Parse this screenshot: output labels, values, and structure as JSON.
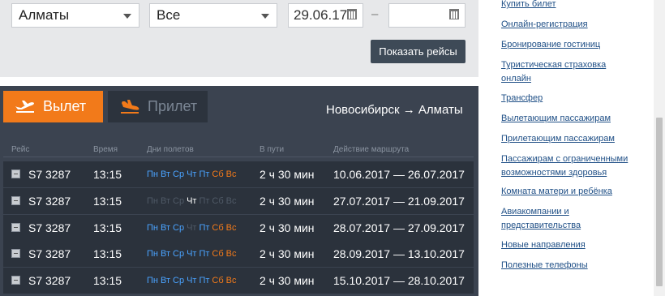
{
  "filters": {
    "city_value": "Алматы",
    "airline_value": "Все",
    "date_from": "29.06.17",
    "date_to": "",
    "dash": "–",
    "show_button": "Показать рейсы"
  },
  "board": {
    "tab_departure": "Вылет",
    "tab_arrival": "Прилет",
    "route": "Новосибирск → Алматы",
    "headers": {
      "flight": "Рейс",
      "time": "Время",
      "days": "Дни полетов",
      "duration": "В пути",
      "validity": "Действие маршрута"
    },
    "day_names": [
      "Пн",
      "Вт",
      "Ср",
      "Чт",
      "Пт",
      "Сб",
      "Вс"
    ],
    "rows": [
      {
        "flight": "S7 3287",
        "time": "13:15",
        "days_active": [
          1,
          1,
          1,
          1,
          1,
          1,
          1
        ],
        "duration": "2 ч 30 мин",
        "validity": "10.06.2017 — 26.07.2017"
      },
      {
        "flight": "S7 3287",
        "time": "13:15",
        "days_active": [
          0,
          0,
          0,
          1,
          0,
          0,
          0
        ],
        "duration": "2 ч 30 мин",
        "validity": "27.07.2017 — 21.09.2017"
      },
      {
        "flight": "S7 3287",
        "time": "13:15",
        "days_active": [
          1,
          1,
          1,
          0,
          1,
          1,
          1
        ],
        "duration": "2 ч 30 мин",
        "validity": "28.07.2017 — 27.09.2017"
      },
      {
        "flight": "S7 3287",
        "time": "13:15",
        "days_active": [
          1,
          1,
          1,
          1,
          1,
          1,
          1
        ],
        "duration": "2 ч 30 мин",
        "validity": "28.09.2017 — 13.10.2017"
      },
      {
        "flight": "S7 3287",
        "time": "13:15",
        "days_active": [
          1,
          1,
          1,
          1,
          1,
          1,
          1
        ],
        "duration": "2 ч 30 мин",
        "validity": "15.10.2017 — 28.10.2017"
      }
    ]
  },
  "sidebar": {
    "links": [
      {
        "label": "Купить билет"
      },
      {
        "label": "Онлайн-регистрация"
      },
      {
        "label": "Бронирование гостиниц"
      },
      {
        "label": "Туристическая страховка онлайн"
      },
      {
        "label": "Трансфер"
      },
      {
        "label": "Вылетающим пассажирам"
      },
      {
        "label": "Прилетающим пассажирам"
      },
      {
        "label": "Пассажирам с ограниченными возможностями здоровья"
      },
      {
        "label": "Комната матери и ребёнка"
      },
      {
        "label": "Авиакомпании и представительства"
      },
      {
        "label": "Новые направления"
      },
      {
        "label": "Полезные телефоны"
      }
    ]
  },
  "colors": {
    "accent": "#f27a1a",
    "board_bg": "#3b4350",
    "row_bg": "#2b323c",
    "weekday": "#4aa3ff",
    "weekend": "#f27a1a",
    "link": "#1f4f86"
  },
  "icons": [
    "chevron-down-icon",
    "calendar-icon",
    "plane-takeoff-icon",
    "plane-landing-icon",
    "flight-info-icon"
  ]
}
